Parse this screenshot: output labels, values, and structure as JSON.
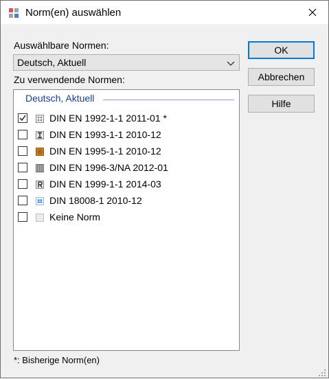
{
  "window": {
    "title": "Norm(en) auswählen"
  },
  "labels": {
    "available": "Auswählbare Normen:",
    "to_use": "Zu verwendende Normen:"
  },
  "combo": {
    "value": "Deutsch, Aktuell"
  },
  "list": {
    "group_header": "Deutsch, Aktuell",
    "items": [
      {
        "label": "DIN EN 1992-1-1 2011-01 *",
        "checked": true,
        "icon": "concrete-icon"
      },
      {
        "label": "DIN EN 1993-1-1 2010-12",
        "checked": false,
        "icon": "steel-beam-icon"
      },
      {
        "label": "DIN EN 1995-1-1 2010-12",
        "checked": false,
        "icon": "timber-icon"
      },
      {
        "label": "DIN EN 1996-3/NA 2012-01",
        "checked": false,
        "icon": "masonry-icon"
      },
      {
        "label": "DIN EN 1999-1-1 2014-03",
        "checked": false,
        "icon": "aluminium-icon"
      },
      {
        "label": "DIN 18008-1 2010-12",
        "checked": false,
        "icon": "glass-icon"
      },
      {
        "label": "Keine Norm",
        "checked": false,
        "icon": "no-norm-icon"
      }
    ]
  },
  "buttons": {
    "ok": "OK",
    "cancel": "Abbrechen",
    "help": "Hilfe"
  },
  "footnote": "*: Bisherige Norm(en)",
  "colors": {
    "accent": "#0078d7",
    "group_header": "#1e3d8c"
  }
}
